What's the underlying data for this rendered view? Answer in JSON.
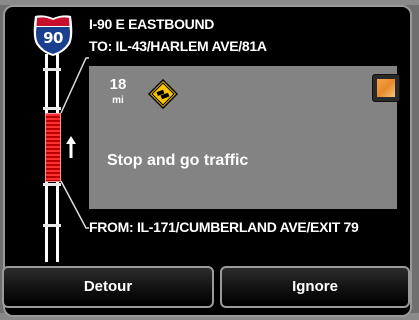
{
  "route": {
    "shield_number": "90",
    "title": "I-90 E EASTBOUND",
    "to": "TO: IL-43/HARLEM AVE/81A",
    "from": "FROM: IL-171/CUMBERLAND AVE/EXIT 79"
  },
  "incident": {
    "distance": "18",
    "distance_unit": "mi",
    "icon": "traffic-warning-icon",
    "message": "Stop and go traffic"
  },
  "actions": {
    "detour_label": "Detour",
    "ignore_label": "Ignore"
  },
  "colors": {
    "jam": "#ff3030",
    "panel": "#838383",
    "shield_blue": "#1a3f8f",
    "shield_red": "#c8102e",
    "warning_yellow": "#f7c600"
  }
}
